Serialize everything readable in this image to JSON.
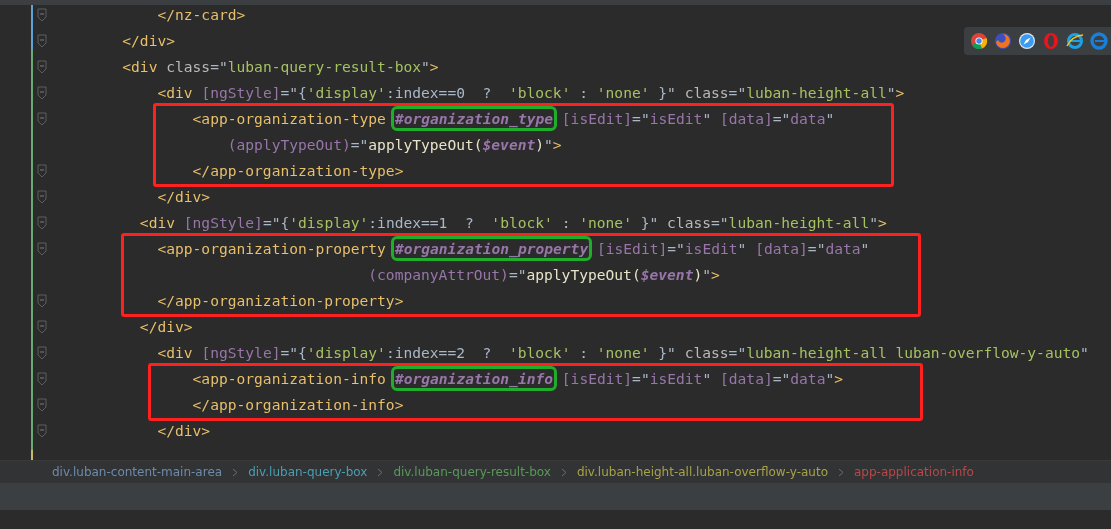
{
  "editor": {
    "blocks": [
      {
        "boxed": false,
        "lines": [
          {
            "fold": true,
            "tokens": [
              {
                "kind": "tag",
                "text": "            </nz-card>"
              }
            ]
          },
          {
            "fold": true,
            "tokens": [
              {
                "kind": "tag",
                "text": "        </div>"
              }
            ]
          },
          {
            "fold": true,
            "tokens": [
              {
                "kind": "tag",
                "text": "        <div"
              },
              {
                "kind": "attr",
                "text": " class"
              },
              {
                "kind": "punct",
                "text": "=\""
              },
              {
                "kind": "str",
                "text": "luban-query-result-box"
              },
              {
                "kind": "punct",
                "text": "\""
              },
              {
                "kind": "tag",
                "text": ">"
              }
            ]
          },
          {
            "fold": true,
            "tokens": [
              {
                "kind": "tag",
                "text": "            <div"
              },
              {
                "kind": "bind",
                "text": " [ngStyle]"
              },
              {
                "kind": "punct",
                "text": "=\"{"
              },
              {
                "kind": "str",
                "text": "'display'"
              },
              {
                "kind": "punct",
                "text": ":index==0  ?  "
              },
              {
                "kind": "str",
                "text": "'block'"
              },
              {
                "kind": "punct",
                "text": " : "
              },
              {
                "kind": "str",
                "text": "'none'"
              },
              {
                "kind": "punct",
                "text": " }\""
              },
              {
                "kind": "attr",
                "text": " class"
              },
              {
                "kind": "punct",
                "text": "=\""
              },
              {
                "kind": "str",
                "text": "luban-height-all"
              },
              {
                "kind": "punct",
                "text": "\""
              },
              {
                "kind": "tag",
                "text": ">"
              }
            ]
          }
        ]
      },
      {
        "boxed": true,
        "lines": [
          {
            "fold": true,
            "tokens": [
              {
                "kind": "tag",
                "text": "                <app-organization-type"
              },
              {
                "kind": "ref",
                "text": "#organization_type",
                "marked": true
              },
              {
                "kind": "bind",
                "text": " [isEdit]"
              },
              {
                "kind": "punct",
                "text": "=\""
              },
              {
                "kind": "var",
                "text": "isEdit"
              },
              {
                "kind": "punct",
                "text": "\""
              },
              {
                "kind": "bind",
                "text": " [data]"
              },
              {
                "kind": "punct",
                "text": "=\""
              },
              {
                "kind": "var",
                "text": "data"
              },
              {
                "kind": "punct",
                "text": "\""
              }
            ]
          },
          {
            "fold": false,
            "tokens": [
              {
                "kind": "bind",
                "text": "                    (applyTypeOut)"
              },
              {
                "kind": "punct",
                "text": "=\""
              },
              {
                "kind": "fn",
                "text": "applyTypeOut("
              },
              {
                "kind": "param",
                "text": "$event"
              },
              {
                "kind": "fn",
                "text": ")"
              },
              {
                "kind": "punct",
                "text": "\""
              },
              {
                "kind": "tag",
                "text": ">"
              }
            ]
          },
          {
            "fold": true,
            "tokens": [
              {
                "kind": "tag",
                "text": "                </app-organization-type>"
              }
            ]
          }
        ]
      },
      {
        "boxed": false,
        "lines": [
          {
            "fold": true,
            "tokens": [
              {
                "kind": "tag",
                "text": "            </div>"
              }
            ]
          },
          {
            "fold": true,
            "tokens": [
              {
                "kind": "tag",
                "text": "          <div"
              },
              {
                "kind": "bind",
                "text": " [ngStyle]"
              },
              {
                "kind": "punct",
                "text": "=\"{"
              },
              {
                "kind": "str",
                "text": "'display'"
              },
              {
                "kind": "punct",
                "text": ":index==1  ?  "
              },
              {
                "kind": "str",
                "text": "'block'"
              },
              {
                "kind": "punct",
                "text": " : "
              },
              {
                "kind": "str",
                "text": "'none'"
              },
              {
                "kind": "punct",
                "text": " }\""
              },
              {
                "kind": "attr",
                "text": " class"
              },
              {
                "kind": "punct",
                "text": "=\""
              },
              {
                "kind": "str",
                "text": "luban-height-all"
              },
              {
                "kind": "punct",
                "text": "\""
              },
              {
                "kind": "tag",
                "text": ">"
              }
            ]
          }
        ]
      },
      {
        "boxed": true,
        "lines": [
          {
            "fold": true,
            "tokens": [
              {
                "kind": "tag",
                "text": "            <app-organization-property"
              },
              {
                "kind": "ref",
                "text": "#organization_property",
                "marked": true
              },
              {
                "kind": "bind",
                "text": " [isEdit]"
              },
              {
                "kind": "punct",
                "text": "=\""
              },
              {
                "kind": "var",
                "text": "isEdit"
              },
              {
                "kind": "punct",
                "text": "\""
              },
              {
                "kind": "bind",
                "text": " [data]"
              },
              {
                "kind": "punct",
                "text": "=\""
              },
              {
                "kind": "var",
                "text": "data"
              },
              {
                "kind": "punct",
                "text": "\""
              }
            ]
          },
          {
            "fold": false,
            "tokens": [
              {
                "kind": "bind",
                "text": "                                    (companyAttrOut)"
              },
              {
                "kind": "punct",
                "text": "=\""
              },
              {
                "kind": "fn",
                "text": "applyTypeOut("
              },
              {
                "kind": "param",
                "text": "$event"
              },
              {
                "kind": "fn",
                "text": ")"
              },
              {
                "kind": "punct",
                "text": "\""
              },
              {
                "kind": "tag",
                "text": ">"
              }
            ]
          },
          {
            "fold": true,
            "tokens": [
              {
                "kind": "tag",
                "text": "            </app-organization-property>"
              }
            ]
          }
        ]
      },
      {
        "boxed": false,
        "lines": [
          {
            "fold": true,
            "tokens": [
              {
                "kind": "tag",
                "text": "          </div>"
              }
            ]
          },
          {
            "fold": true,
            "tokens": [
              {
                "kind": "tag",
                "text": "            <div"
              },
              {
                "kind": "bind",
                "text": " [ngStyle]"
              },
              {
                "kind": "punct",
                "text": "=\"{"
              },
              {
                "kind": "str",
                "text": "'display'"
              },
              {
                "kind": "punct",
                "text": ":index==2  ?  "
              },
              {
                "kind": "str",
                "text": "'block'"
              },
              {
                "kind": "punct",
                "text": " : "
              },
              {
                "kind": "str",
                "text": "'none'"
              },
              {
                "kind": "punct",
                "text": " }\""
              },
              {
                "kind": "attr",
                "text": " class"
              },
              {
                "kind": "punct",
                "text": "=\""
              },
              {
                "kind": "str",
                "text": "luban-height-all luban-overflow-y-auto"
              },
              {
                "kind": "punct",
                "text": "\""
              }
            ]
          }
        ]
      },
      {
        "boxed": true,
        "lines": [
          {
            "fold": true,
            "tokens": [
              {
                "kind": "tag",
                "text": "                <app-organization-info"
              },
              {
                "kind": "ref",
                "text": "#organization_info",
                "marked": true
              },
              {
                "kind": "bind",
                "text": " [isEdit]"
              },
              {
                "kind": "punct",
                "text": "=\""
              },
              {
                "kind": "var",
                "text": "isEdit"
              },
              {
                "kind": "punct",
                "text": "\""
              },
              {
                "kind": "bind",
                "text": " [data]"
              },
              {
                "kind": "punct",
                "text": "=\""
              },
              {
                "kind": "var",
                "text": "data"
              },
              {
                "kind": "punct",
                "text": "\""
              },
              {
                "kind": "tag",
                "text": ">"
              }
            ]
          },
          {
            "fold": true,
            "tokens": [
              {
                "kind": "tag",
                "text": "                </app-organization-info>"
              }
            ]
          }
        ]
      },
      {
        "boxed": false,
        "lines": [
          {
            "fold": true,
            "tokens": [
              {
                "kind": "tag",
                "text": "            </div>"
              }
            ]
          }
        ]
      }
    ]
  },
  "browser_bar": {
    "icons": [
      {
        "kind": "chrome"
      },
      {
        "kind": "firefox"
      },
      {
        "kind": "safari"
      },
      {
        "kind": "opera"
      },
      {
        "kind": "ie"
      },
      {
        "kind": "edge"
      }
    ]
  },
  "breadcrumbs": [
    {
      "label": "div.luban-content-main-area",
      "color": "#6e8bac"
    },
    {
      "label": "div.luban-query-box",
      "color": "#4a9eb0"
    },
    {
      "label": "div.luban-query-result-box",
      "color": "#5a9a57"
    },
    {
      "label": "div.luban-height-all.luban-overflow-y-auto",
      "color": "#a8a247"
    },
    {
      "label": "app-application-info",
      "color": "#b9484a"
    }
  ]
}
